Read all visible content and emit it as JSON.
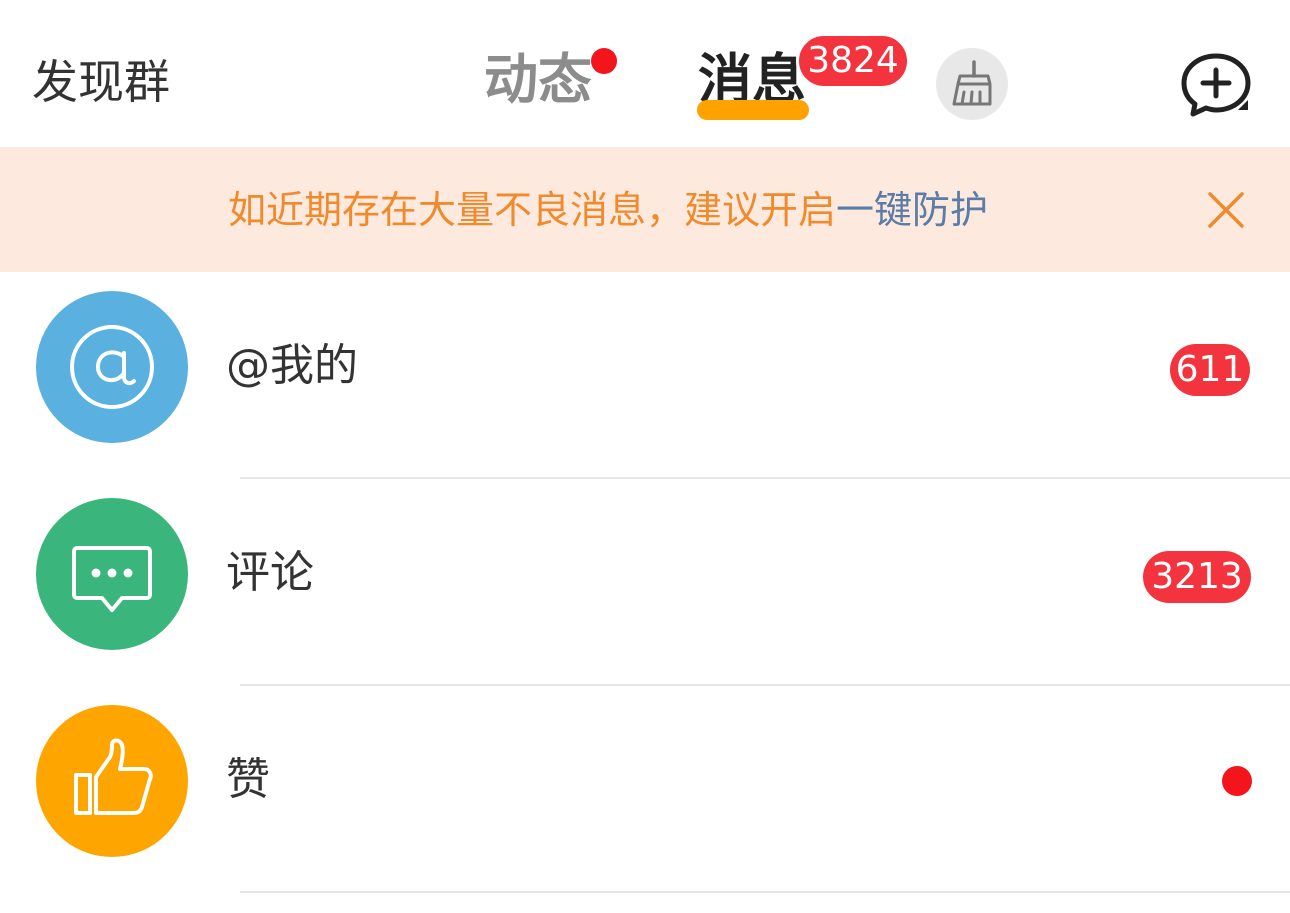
{
  "header": {
    "discover_label": "发现群",
    "tabs": [
      {
        "label": "动态",
        "has_dot": true
      },
      {
        "label": "消息",
        "badge": "3824",
        "selected": true
      }
    ],
    "clean_icon": "broom-icon",
    "compose_icon": "chat-plus-icon"
  },
  "banner": {
    "text": "如近期存在大量不良消息，建议开启",
    "link": "一键防护",
    "close_icon": "close-icon"
  },
  "list": [
    {
      "label": "@我的",
      "icon": "at-icon",
      "color": "#5ab0de",
      "badge": "611"
    },
    {
      "label": "评论",
      "icon": "comment-icon",
      "color": "#3ab67c",
      "badge": "3213"
    },
    {
      "label": "赞",
      "icon": "thumbs-up-icon",
      "color": "#ffa500",
      "dot": true
    }
  ],
  "colors": {
    "accent": "#ffa200",
    "badge": "#f3343e",
    "banner_bg": "#fde9dd",
    "banner_text": "#f08a2c",
    "banner_link": "#5a7ca8"
  }
}
